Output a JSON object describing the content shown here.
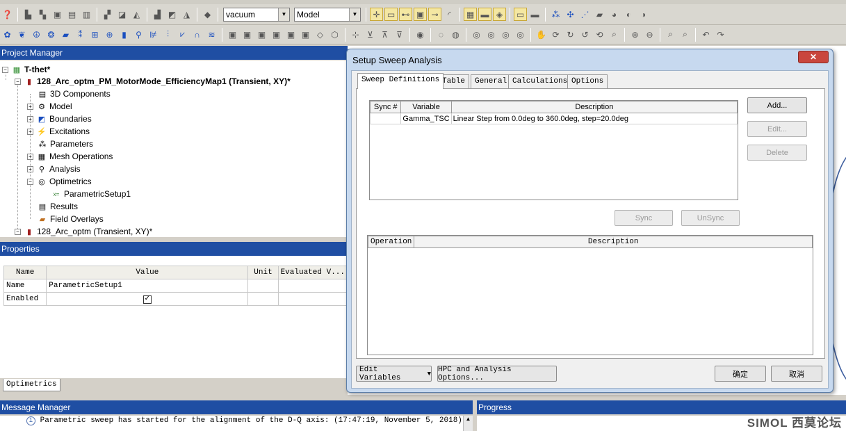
{
  "toolbar": {
    "material_combo": "vacuum",
    "model_combo": "Model"
  },
  "project_manager": {
    "header": "Project Manager",
    "tree": [
      {
        "label": "T-thet*",
        "bold": true
      },
      {
        "label": "128_Arc_optm_PM_MotorMode_EfficiencyMap1 (Transient, XY)*",
        "bold": true
      },
      {
        "label": "3D Components"
      },
      {
        "label": "Model"
      },
      {
        "label": "Boundaries"
      },
      {
        "label": "Excitations"
      },
      {
        "label": "Parameters"
      },
      {
        "label": "Mesh Operations"
      },
      {
        "label": "Analysis"
      },
      {
        "label": "Optimetrics"
      },
      {
        "label": "ParametricSetup1"
      },
      {
        "label": "Results"
      },
      {
        "label": "Field Overlays"
      },
      {
        "label": "128_Arc_optm (Transient, XY)*"
      }
    ]
  },
  "properties": {
    "header": "Properties",
    "columns": [
      "Name",
      "Value",
      "Unit",
      "Evaluated V..."
    ],
    "rows": [
      {
        "name": "Name",
        "value": "ParametricSetup1"
      },
      {
        "name": "Enabled",
        "value": "✓"
      }
    ],
    "tab": "Optimetrics"
  },
  "message_manager": {
    "header": "Message Manager",
    "pin": "ᵖ",
    "close": "×",
    "message": "Parametric sweep has started for the alignment of the D-Q axis: (17:47:19, November 5, 2018)"
  },
  "progress": {
    "header": "Progress"
  },
  "dialog": {
    "title": "Setup Sweep Analysis",
    "tabs": [
      "Sweep Definitions",
      "Table",
      "General",
      "Calculations",
      "Options"
    ],
    "sweep_columns": [
      "Sync #",
      "Variable",
      "Description"
    ],
    "sweep_rows": [
      {
        "sync": "",
        "variable": "Gamma_TSC",
        "description": "Linear Step from 0.0deg to 360.0deg, step=20.0deg"
      }
    ],
    "buttons": {
      "add": "Add...",
      "edit": "Edit...",
      "delete": "Delete",
      "sync": "Sync",
      "unsync": "UnSync",
      "edit_variables": "Edit Variables",
      "hpc": "HPC and Analysis Options...",
      "ok": "确定",
      "cancel": "取消"
    },
    "operation_columns": [
      "Operation",
      "Description"
    ]
  },
  "watermark": "SIMOL 西莫论坛"
}
